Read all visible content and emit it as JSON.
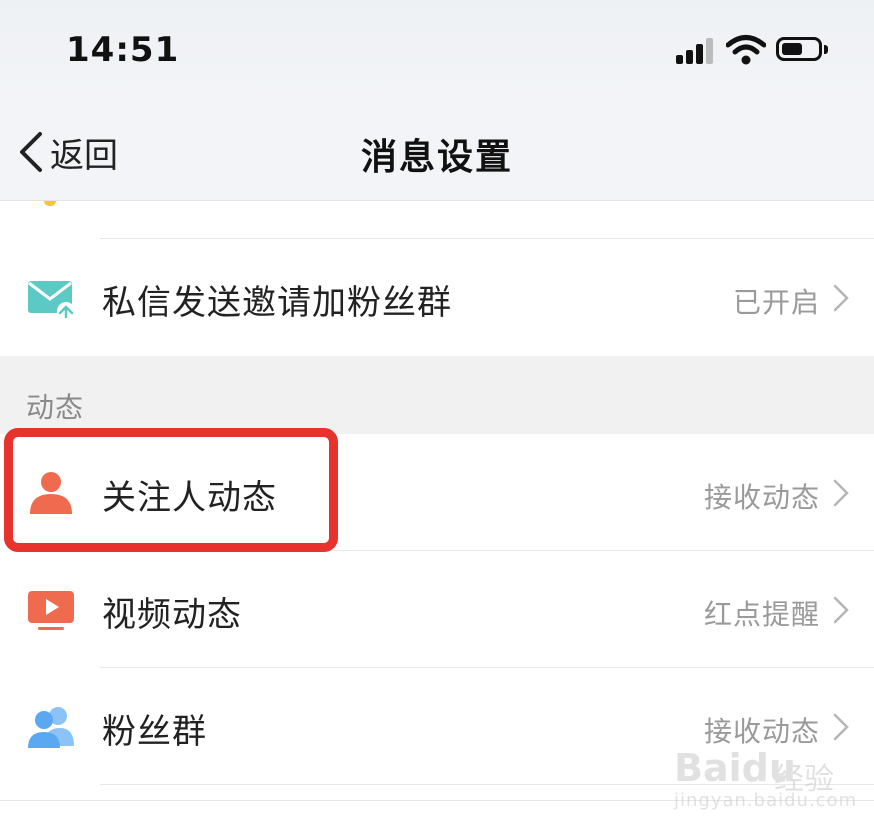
{
  "status_bar": {
    "time": "14:51"
  },
  "nav": {
    "back_label": "返回",
    "title": "消息设置"
  },
  "rows_top": [
    {
      "label": "私信发送邀请加粉丝群",
      "value": "已开启",
      "icon": "envelope-share-icon",
      "color": "#5cc9c4"
    }
  ],
  "section": {
    "title": "动态"
  },
  "rows": [
    {
      "label": "关注人动态",
      "value": "接收动态",
      "icon": "person-icon",
      "color": "#ef6a4f"
    },
    {
      "label": "视频动态",
      "value": "红点提醒",
      "icon": "video-play-icon",
      "color": "#ef6a4f"
    },
    {
      "label": "粉丝群",
      "value": "接收动态",
      "icon": "group-users-icon",
      "color": "#5aa7f2"
    }
  ],
  "highlight": {
    "color": "#e8322d"
  },
  "watermark": {
    "brand": "Baidu",
    "suffix": "经验",
    "url": "jingyan.baidu.com"
  }
}
